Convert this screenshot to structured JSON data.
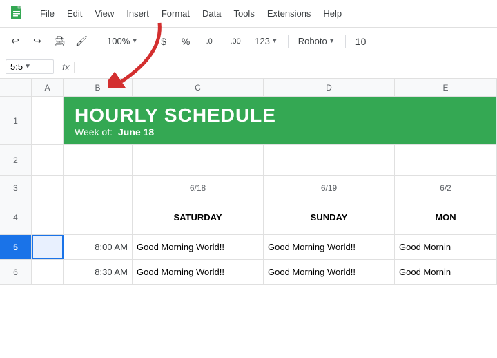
{
  "app": {
    "logo_color": "#0f9d58",
    "title": "Google Sheets"
  },
  "menu": {
    "items": [
      "File",
      "Edit",
      "View",
      "Insert",
      "Format",
      "Data",
      "Tools",
      "Extensions",
      "Help"
    ]
  },
  "toolbar": {
    "zoom": "100%",
    "currency": "$",
    "percent": "%",
    "decimal_decrease": ".0",
    "decimal_increase": ".00",
    "format_123": "123",
    "font": "Roboto",
    "font_size": "10"
  },
  "formula_bar": {
    "cell_ref": "5:5",
    "formula_icon": "fx"
  },
  "grid": {
    "col_headers": [
      "",
      "A",
      "B",
      "C",
      "D",
      "E"
    ],
    "rows": [
      {
        "num": "1",
        "type": "merged_header",
        "title": "HOURLY SCHEDULE",
        "week_label": "Week of:",
        "week_date": "June 18"
      },
      {
        "num": "2",
        "type": "empty"
      },
      {
        "num": "3",
        "type": "dates",
        "cells": [
          "",
          "",
          "",
          "6/18",
          "6/19",
          "6/2"
        ]
      },
      {
        "num": "4",
        "type": "days",
        "cells": [
          "",
          "",
          "",
          "SATURDAY",
          "SUNDAY",
          "MON"
        ]
      },
      {
        "num": "5",
        "type": "data",
        "selected": true,
        "cells": [
          "",
          "",
          "8:00 AM",
          "Good Morning World!!",
          "Good Morning World!!",
          "Good Mornin"
        ]
      },
      {
        "num": "6",
        "type": "data",
        "selected": false,
        "cells": [
          "",
          "",
          "8:30 AM",
          "Good Morning World!!",
          "Good Morning World!!",
          "Good Mornin"
        ]
      }
    ]
  }
}
